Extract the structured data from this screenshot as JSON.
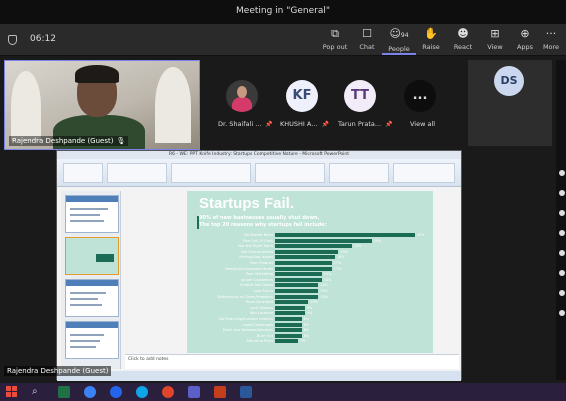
{
  "window": {
    "title": "Meeting in \"General\""
  },
  "toolbar": {
    "timer": "06:12",
    "people_count": "94",
    "buttons": [
      {
        "label": "Pop out",
        "icon": "pop-out-icon"
      },
      {
        "label": "Chat",
        "icon": "chat-icon"
      },
      {
        "label": "People",
        "icon": "people-icon"
      },
      {
        "label": "Raise",
        "icon": "raise-hand-icon"
      },
      {
        "label": "React",
        "icon": "react-icon"
      },
      {
        "label": "View",
        "icon": "view-icon"
      },
      {
        "label": "Apps",
        "icon": "apps-icon"
      },
      {
        "label": "More",
        "icon": "more-icon"
      }
    ]
  },
  "self_tile": {
    "name": "Rajendra Deshpande (Guest)"
  },
  "participants": [
    {
      "initials": "",
      "name": "Dr. Shaifali ..."
    },
    {
      "initials": "KF",
      "name": "KHUSHI A..."
    },
    {
      "initials": "TT",
      "name": "Tarun Prata..."
    },
    {
      "initials": "...",
      "name": "View all"
    }
  ],
  "ds_tile": {
    "initials": "DS"
  },
  "share": {
    "app_title": "R6 - WE: PPT Knife Industry: Startups Competitive Nature - Microsoft PowerPoint",
    "presenter": "Rajendra Deshpande (Guest)",
    "notes_placeholder": "Click to add notes",
    "slide": {
      "title": "Startups Fail.",
      "subtitle_1": "90% of new businesses usually shut down.",
      "subtitle_2": "The top 20 reasons why startups fail include:"
    }
  },
  "chart_data": {
    "type": "bar",
    "title": "Startups Fail.",
    "categories": [
      "No Market Need",
      "Ran Out Of Cash",
      "Not the Right Team",
      "Get Outcompeted",
      "Pricing/Cost Issues",
      "Poor Product",
      "Need/Lack Business Model",
      "Poor Marketing",
      "Ignore Customers",
      "Product Mis-Timed",
      "Lose Focus",
      "Disharmony on Team/Investors",
      "Pivot Gone Bad",
      "Lack Passion",
      "Bad Location",
      "No Financing/Investor Interest",
      "Legal Challenges",
      "Don't Use Network/Advisors",
      "Burn Out",
      "Failure to Pivot"
    ],
    "values": [
      42,
      29,
      23,
      19,
      18,
      17,
      17,
      14,
      14,
      13,
      13,
      13,
      10,
      9,
      9,
      8,
      8,
      8,
      8,
      7
    ],
    "value_labels": [
      "42%",
      "29%",
      "23%",
      "19%",
      "18%",
      "17%",
      "17%",
      "14%",
      "14%",
      "13%",
      "13%",
      "13%",
      "10%",
      "9%",
      "9%",
      "8%",
      "8%",
      "8%",
      "8%",
      "7%"
    ],
    "xlim": [
      0,
      45
    ],
    "colors": {
      "bar": "#1b6b55",
      "background": "#bfe3d6"
    }
  }
}
